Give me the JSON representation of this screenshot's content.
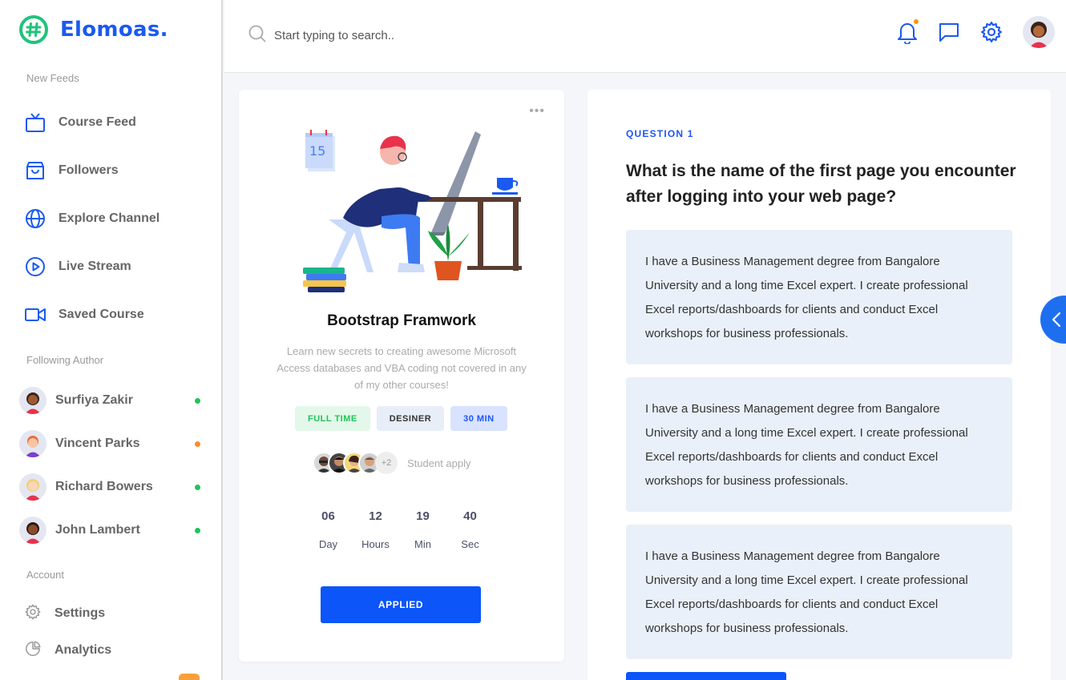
{
  "brand": {
    "name": "Elomoas.",
    "accent": "#1a5af0",
    "logo_color": "#21c37b"
  },
  "sidebar": {
    "feeds_label": "New Feeds",
    "feeds": [
      {
        "label": "Course Feed",
        "icon": "tv-icon"
      },
      {
        "label": "Followers",
        "icon": "bag-icon"
      },
      {
        "label": "Explore Channel",
        "icon": "globe-icon"
      },
      {
        "label": "Live Stream",
        "icon": "play-circle-icon"
      },
      {
        "label": "Saved Course",
        "icon": "video-camera-icon"
      }
    ],
    "authors_label": "Following Author",
    "authors": [
      {
        "name": "Surfiya Zakir",
        "status_color": "#20c35a"
      },
      {
        "name": "Vincent Parks",
        "status_color": "#ff8b2d"
      },
      {
        "name": "Richard Bowers",
        "status_color": "#20c35a"
      },
      {
        "name": "John Lambert",
        "status_color": "#20c35a"
      }
    ],
    "account_label": "Account",
    "account": [
      {
        "label": "Settings",
        "icon": "gear-icon"
      },
      {
        "label": "Analytics",
        "icon": "pie-chart-icon"
      }
    ]
  },
  "header": {
    "search_placeholder": "Start typing to search.."
  },
  "course": {
    "title": "Bootstrap Framwork",
    "description": "Learn new secrets to creating awesome Microsoft Access databases and VBA coding not covered in any of my other courses!",
    "calendar_day": "15",
    "tags": [
      "FULL TIME",
      "DESINER",
      "30 MIN"
    ],
    "students_more": "+2",
    "students_label": "Student apply",
    "countdown": [
      {
        "value": "06",
        "unit": "Day"
      },
      {
        "value": "12",
        "unit": "Hours"
      },
      {
        "value": "19",
        "unit": "Min"
      },
      {
        "value": "40",
        "unit": "Sec"
      }
    ],
    "button": "APPLIED"
  },
  "question": {
    "label": "QUESTION 1",
    "text": "What is the name of the first page you encounter after logging into your web page?",
    "answers": [
      "I have a Business Management degree from Bangalore University and a long time Excel expert. I create professional Excel reports/dashboards for clients and conduct Excel workshops for business professionals.",
      "I have a Business Management degree from Bangalore University and a long time Excel expert. I create professional Excel reports/dashboards for clients and conduct Excel workshops for business professionals.",
      "I have a Business Management degree from Bangalore University and a long time Excel expert. I create professional Excel reports/dashboards for clients and conduct Excel workshops for business professionals."
    ]
  }
}
